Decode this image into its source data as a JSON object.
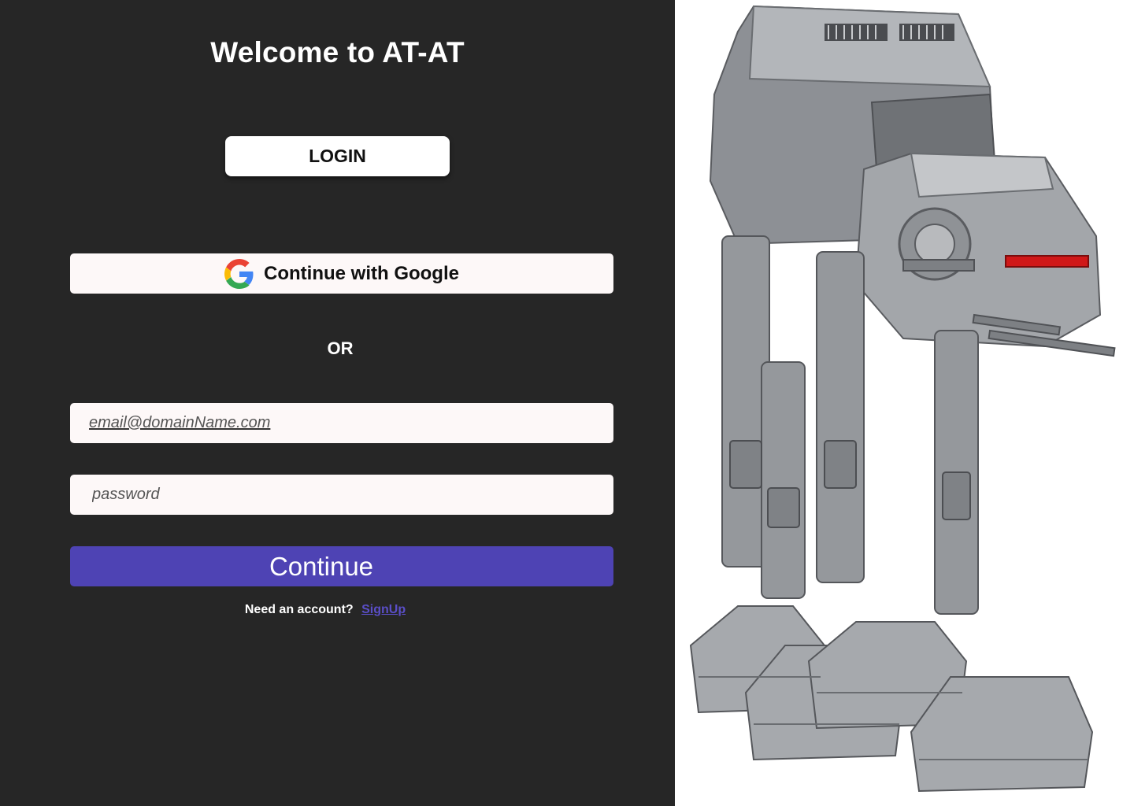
{
  "header": {
    "title": "Welcome to AT-AT"
  },
  "login_tab": {
    "label": "LOGIN"
  },
  "google": {
    "label": "Continue with Google",
    "icon": "google-logo-icon"
  },
  "divider": {
    "label": "OR"
  },
  "form": {
    "email_placeholder": "email@domainName.com",
    "password_placeholder": "password",
    "continue_label": "Continue"
  },
  "signup": {
    "prompt": "Need an account?",
    "link_label": "SignUp"
  },
  "hero": {
    "image": "at-at-walker-illustration"
  },
  "colors": {
    "background": "#262626",
    "accent": "#4e43b4",
    "link": "#5a4ec7",
    "field": "#fdf8f8"
  }
}
